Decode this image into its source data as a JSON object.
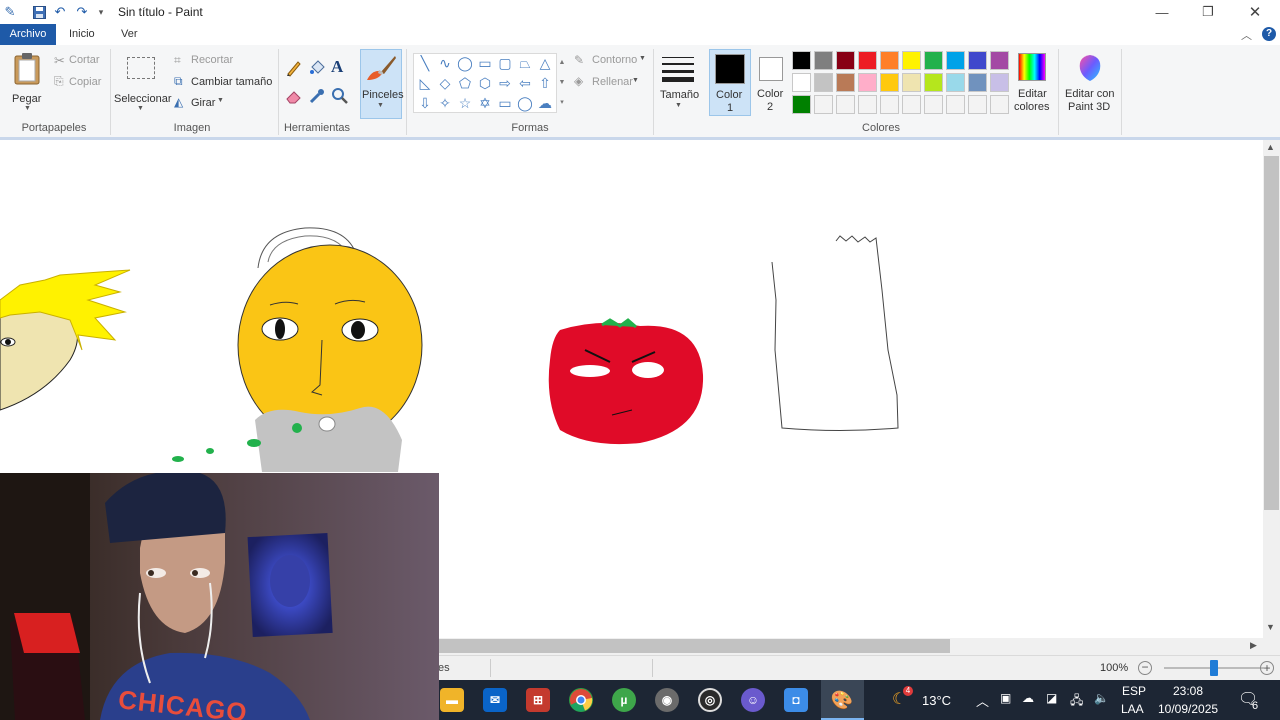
{
  "window": {
    "title": "Sin título - Paint"
  },
  "menu": {
    "tabs": [
      "Archivo",
      "Inicio",
      "Ver"
    ]
  },
  "ribbon": {
    "portapapeles": {
      "paste": "Pegar",
      "cut": "Cortar",
      "copy": "Copiar",
      "label": "Portapapeles"
    },
    "imagen": {
      "select": "Seleccionar",
      "crop": "Recortar",
      "resize": "Cambiar tamaño",
      "rotate": "Girar",
      "label": "Imagen"
    },
    "herramientas": {
      "label": "Herramientas"
    },
    "pinceles": {
      "label": "Pinceles"
    },
    "formas": {
      "outline": "Contorno",
      "fill": "Rellenar",
      "label": "Formas"
    },
    "tamano": {
      "label": "Tamaño"
    },
    "colores": {
      "color1_line1": "Color",
      "color1_line2": "1",
      "color2_line1": "Color",
      "color2_line2": "2",
      "edit_line1": "Editar",
      "edit_line2": "colores",
      "label": "Colores",
      "color1": "#000000",
      "color2": "#ffffff",
      "palette": [
        "#000000",
        "#7f7f7f",
        "#880015",
        "#ed1c24",
        "#ff7f27",
        "#fff200",
        "#22b14c",
        "#00a2e8",
        "#3f48cc",
        "#a349a4",
        "#ffffff",
        "#c3c3c3",
        "#b97a57",
        "#ffaec9",
        "#ffc90e",
        "#efe4b0",
        "#b5e61d",
        "#99d9ea",
        "#7092be",
        "#c8bfe7",
        "#008000",
        "#f3f3f3",
        "#f3f3f3",
        "#f3f3f3",
        "#f3f3f3",
        "#f3f3f3",
        "#f3f3f3",
        "#f3f3f3",
        "#f3f3f3",
        "#f3f3f3"
      ]
    },
    "paint3d": {
      "line1": "Editar con",
      "line2": "Paint 3D"
    }
  },
  "status": {
    "partial_text": "es",
    "zoom": "100%",
    "zoom_level": 0.5
  },
  "taskbar": {
    "weather": "13°C",
    "lang1": "ESP",
    "lang2": "LAA",
    "time": "23:08",
    "date": "10/09/2025",
    "notif_count": "6",
    "weather_badge": "4"
  },
  "webcam": {
    "shirt_text": "CHICAGO"
  }
}
